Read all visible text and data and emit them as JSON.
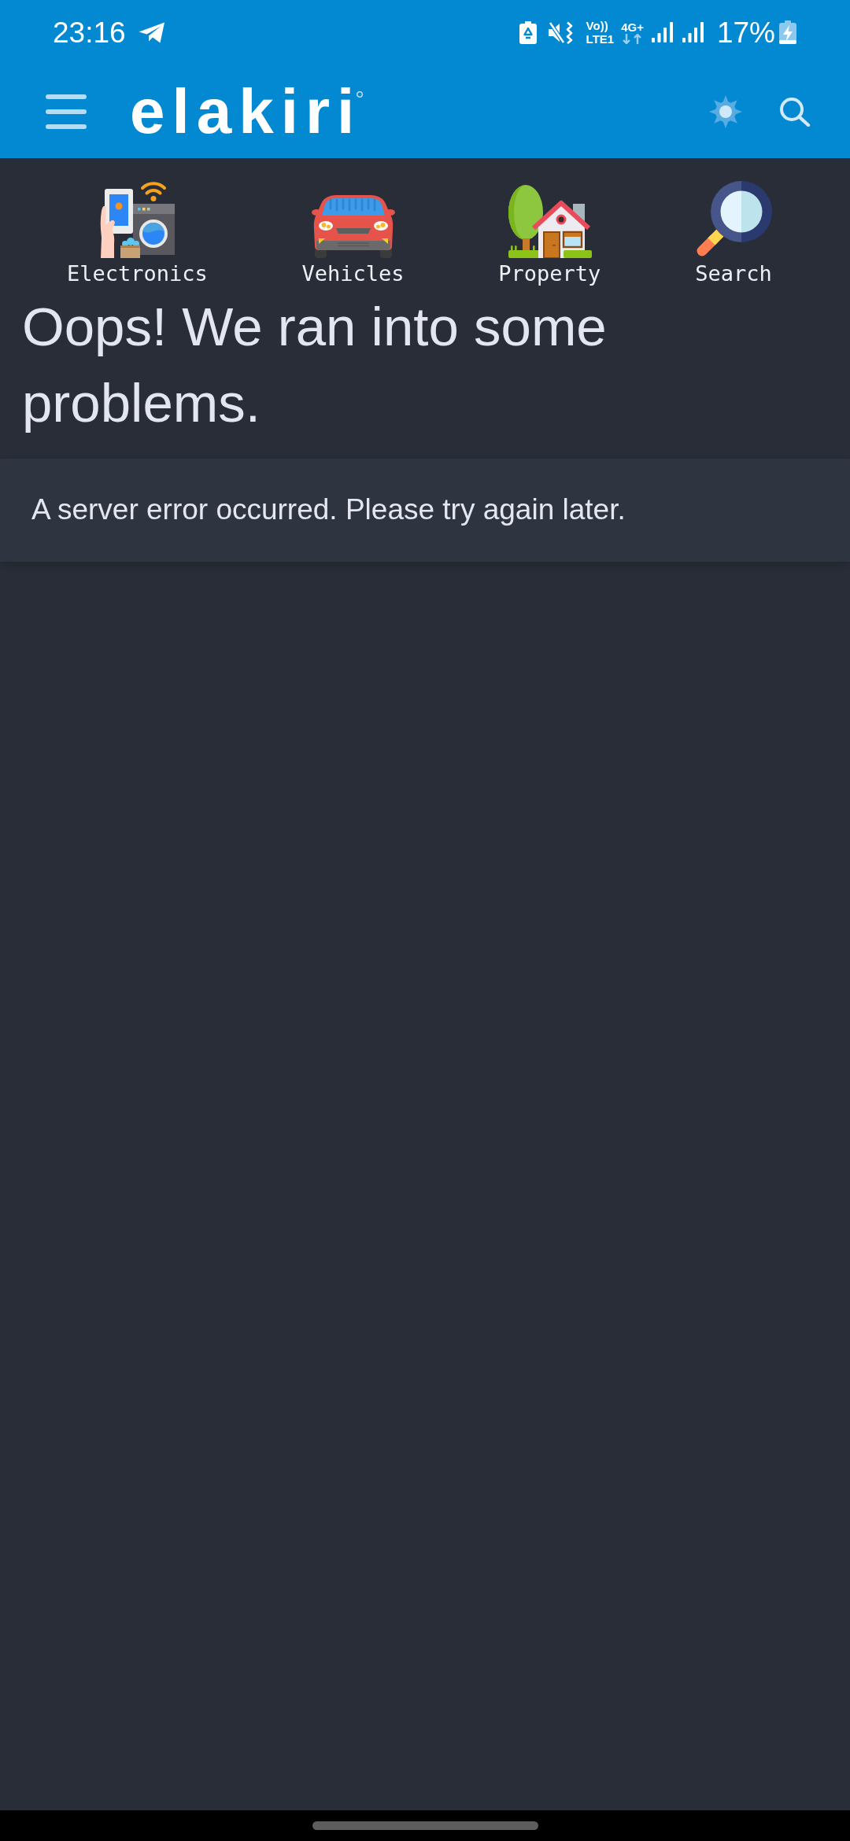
{
  "status_bar": {
    "time": "23:16",
    "volte": "Vo))",
    "lte": "LTE1",
    "network": "4G+",
    "battery": "17%"
  },
  "header": {
    "logo": "elakiri"
  },
  "categories": [
    {
      "kind": "electronics",
      "label": "Electronics"
    },
    {
      "kind": "vehicles",
      "label": "Vehicles"
    },
    {
      "kind": "property",
      "label": "Property"
    },
    {
      "kind": "search",
      "label": "Search"
    }
  ],
  "error": {
    "title": "Oops! We ran into some problems.",
    "message": "A server error occurred. Please try again later."
  }
}
